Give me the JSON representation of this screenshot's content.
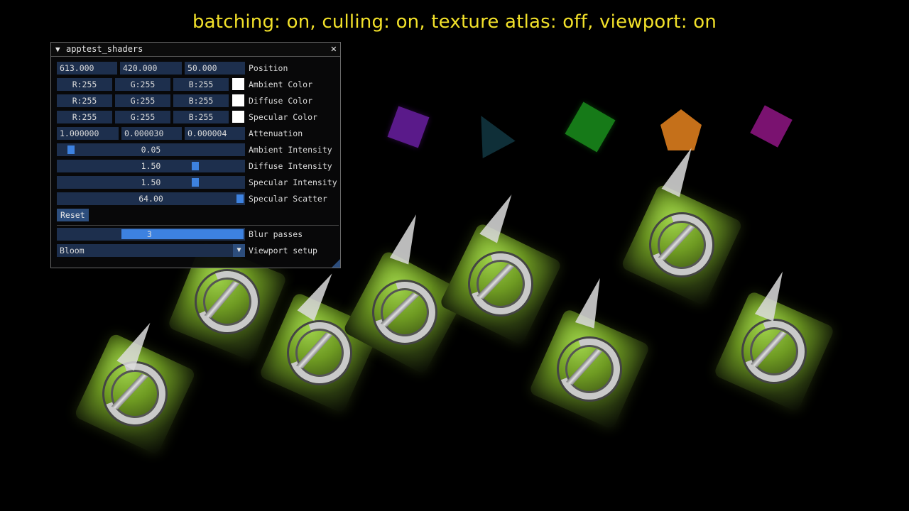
{
  "status_text": "batching: on, culling: on, texture atlas: off, viewport: on",
  "window": {
    "title": "apptest_shaders",
    "collapse_glyph": "▼",
    "close_glyph": "✕"
  },
  "position": {
    "x": "613.000",
    "y": "420.000",
    "z": "50.000",
    "label": "Position"
  },
  "ambient_color": {
    "r": "R:255",
    "g": "G:255",
    "b": "B:255",
    "swatch": "#ffffff",
    "label": "Ambient Color"
  },
  "diffuse_color": {
    "r": "R:255",
    "g": "G:255",
    "b": "B:255",
    "swatch": "#ffffff",
    "label": "Diffuse Color"
  },
  "specular_color": {
    "r": "R:255",
    "g": "G:255",
    "b": "B:255",
    "swatch": "#ffffff",
    "label": "Specular Color"
  },
  "attenuation": {
    "c": "1.000000",
    "l": "0.000030",
    "q": "0.000004",
    "label": "Attenuation"
  },
  "ambient_intensity": {
    "value": "0.05",
    "label": "Ambient Intensity",
    "fraction": 0.05
  },
  "diffuse_intensity": {
    "value": "1.50",
    "label": "Diffuse Intensity",
    "fraction": 0.75
  },
  "specular_intensity": {
    "value": "1.50",
    "label": "Specular Intensity",
    "fraction": 0.75
  },
  "specular_scatter": {
    "value": "64.00",
    "label": "Specular Scatter",
    "fraction": 1.0
  },
  "reset_label": "Reset",
  "blur_passes": {
    "value": "3",
    "label": "Blur passes",
    "fraction": 0.34
  },
  "viewport_setup": {
    "value": "Bloom",
    "label": "Viewport setup",
    "arrow": "▼"
  },
  "colors": {
    "status_text": "#f2e12a",
    "field_bg": "#1d2f4d",
    "accent": "#3d82e0",
    "button": "#2c4d7c",
    "tile_green": "#8fc23a"
  },
  "scene_icons": [
    "purple-cube-icon",
    "teal-cone-icon",
    "green-cube-icon",
    "orange-pentagon-icon",
    "magenta-cube-icon",
    "logo-tile-icon"
  ]
}
